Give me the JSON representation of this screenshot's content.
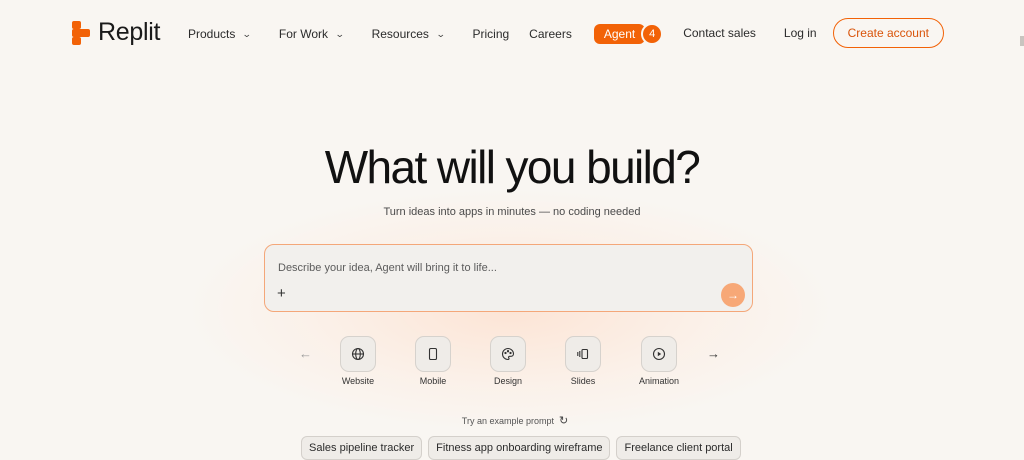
{
  "brand": {
    "name": "Replit",
    "color": "#f26207"
  },
  "nav": {
    "items": [
      {
        "label": "Products",
        "has_menu": true
      },
      {
        "label": "For Work",
        "has_menu": true
      },
      {
        "label": "Resources",
        "has_menu": true
      },
      {
        "label": "Pricing",
        "has_menu": false
      },
      {
        "label": "Careers",
        "has_menu": false
      }
    ],
    "agent": {
      "label": "Agent",
      "badge": "4"
    }
  },
  "header_right": {
    "contact_sales": "Contact sales",
    "log_in": "Log in",
    "create_account": "Create account"
  },
  "hero": {
    "title": "What will you build?",
    "subtitle": "Turn ideas into apps in minutes — no coding needed"
  },
  "prompt": {
    "placeholder": "Describe your idea, Agent will bring it to life...",
    "value": ""
  },
  "categories": [
    {
      "label": "Website",
      "icon": "globe-icon"
    },
    {
      "label": "Mobile",
      "icon": "phone-icon"
    },
    {
      "label": "Design",
      "icon": "palette-icon"
    },
    {
      "label": "Slides",
      "icon": "slides-icon"
    },
    {
      "label": "Animation",
      "icon": "play-icon"
    }
  ],
  "examples": {
    "label": "Try an example prompt",
    "chips": [
      "Sales pipeline tracker",
      "Fitness app onboarding wireframe",
      "Freelance client portal"
    ]
  }
}
